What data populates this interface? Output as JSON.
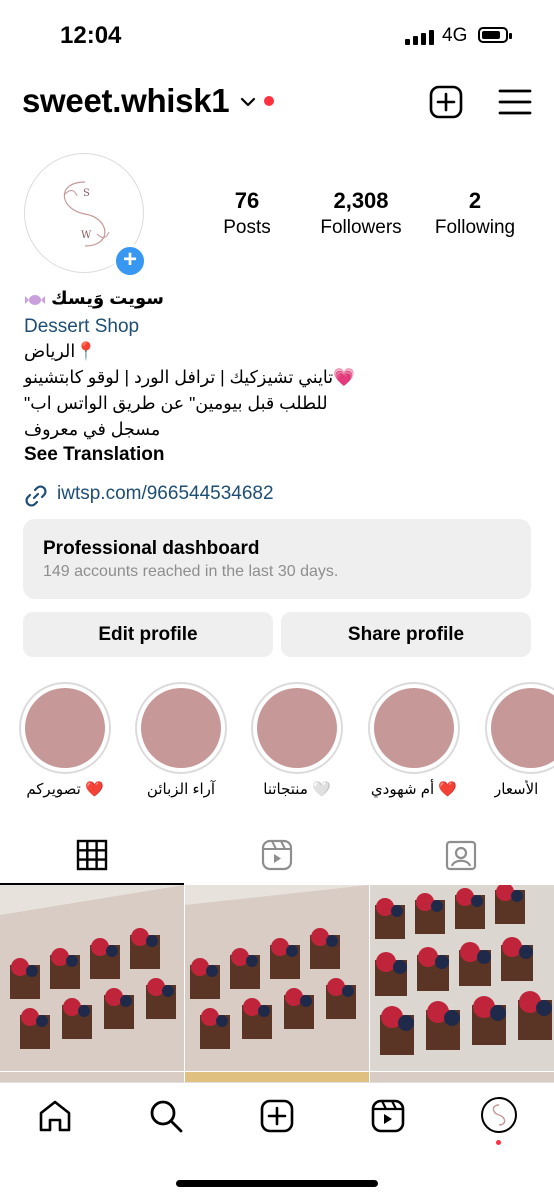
{
  "status_bar": {
    "time": "12:04",
    "network": "4G"
  },
  "header": {
    "username": "sweet.whisk1"
  },
  "profile": {
    "stats": [
      {
        "value": "76",
        "label": "Posts"
      },
      {
        "value": "2,308",
        "label": "Followers"
      },
      {
        "value": "2",
        "label": "Following"
      }
    ],
    "display_name": "سويت وَيسك",
    "category": "Dessert Shop",
    "bio_lines": [
      "الرياض📍",
      "تايني تشيزكيك | ترافل الورد | لوقو كابتشينو💗",
      "\"للطلب قبل بيومين\" عن طريق الواتس اب",
      "مسجل في معروف"
    ],
    "see_translation": "See Translation",
    "link": "iwtsp.com/966544534682"
  },
  "dashboard": {
    "title": "Professional dashboard",
    "subtitle": "149 accounts reached in the last 30 days."
  },
  "buttons": {
    "edit": "Edit profile",
    "share": "Share profile"
  },
  "highlights": [
    {
      "label": "تصويركم ❤️"
    },
    {
      "label": "آراء الزبائن"
    },
    {
      "label": "منتجاتنا 🤍"
    },
    {
      "label": "أم شهودي ❤️"
    },
    {
      "label": "الأسعار"
    }
  ],
  "tabs": [
    "grid-icon",
    "reels-icon",
    "tagged-icon"
  ],
  "nav": [
    "home-icon",
    "search-icon",
    "create-icon",
    "reels-icon",
    "profile-icon"
  ],
  "colors": {
    "link": "#1e4e74",
    "accent_blue": "#3897f0",
    "notification_red": "#ff3040",
    "highlight_pink": "#c69898"
  }
}
